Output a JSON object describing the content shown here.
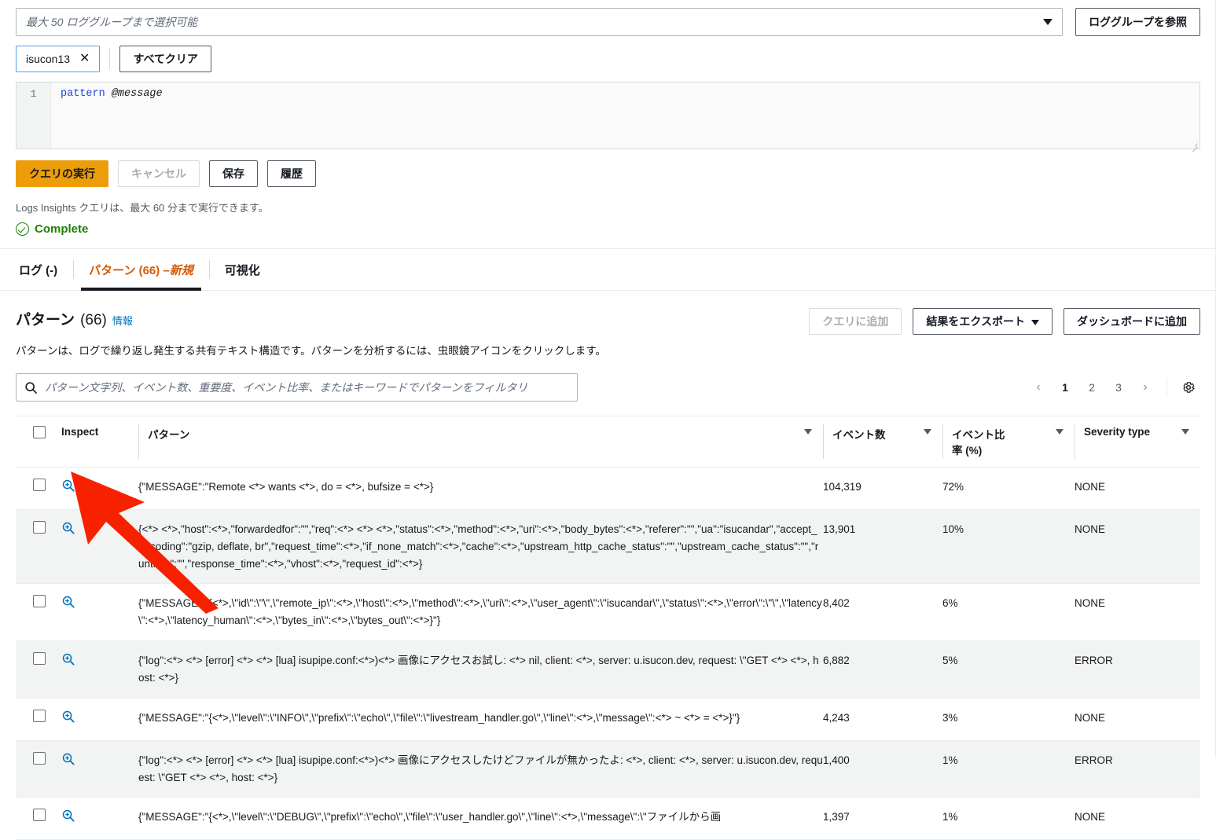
{
  "query_panel": {
    "log_group_placeholder": "最大 50 ロググループまで選択可能",
    "browse_button": "ロググループを参照",
    "selected_tokens": [
      {
        "label": "isucon13",
        "remove": "✕"
      }
    ],
    "clear_all_button": "すべてクリア",
    "editor": {
      "line_number": "1",
      "keyword": "pattern",
      "field": "@message"
    },
    "run_button": "クエリの実行",
    "cancel_button": "キャンセル",
    "save_button": "保存",
    "history_button": "履歴",
    "hint": "Logs Insights クエリは、最大 60 分まで実行できます。",
    "status": "Complete"
  },
  "tabs": [
    {
      "label": "ログ (-)",
      "active": false
    },
    {
      "label": "パターン (66) – ",
      "suffix": "新規",
      "active": true
    },
    {
      "label": "可視化",
      "active": false
    }
  ],
  "patterns_section": {
    "title": "パターン",
    "count": "(66)",
    "info_link": "情報",
    "description": "パターンは、ログで繰り返し発生する共有テキスト構造です。パターンを分析するには、虫眼鏡アイコンをクリックします。",
    "add_to_query_button": "クエリに追加",
    "export_results_button": "結果をエクスポート",
    "add_to_dashboard_button": "ダッシュボードに追加",
    "search_placeholder": "パターン文字列、イベント数、重要度、イベント比率、またはキーワードでパターンをフィルタリ",
    "pagination": {
      "prev": "‹",
      "pages": [
        "1",
        "2",
        "3"
      ],
      "current": "1",
      "next": "›",
      "settings_icon": "gear-icon"
    }
  },
  "table": {
    "columns": {
      "inspect": "Inspect",
      "pattern": "パターン",
      "event_count": "イベント数",
      "event_ratio": "イベント比率 (%)",
      "severity": "Severity type"
    },
    "rows": [
      {
        "pattern": "{\"MESSAGE\":\"Remote <*> wants <*>, do = <*>, bufsize = <*>}",
        "count": "104,319",
        "ratio": "72%",
        "severity": "NONE"
      },
      {
        "pattern": "{<*> <*>,\"host\":<*>,\"forwardedfor\":\"\",\"req\":<*> <*> <*>,\"status\":<*>,\"method\":<*>,\"uri\":<*>,\"body_bytes\":<*>,\"referer\":\"\",\"ua\":\"isucandar\",\"accept_encoding\":\"gzip, deflate, br\",\"request_time\":<*>,\"if_none_match\":<*>,\"cache\":<*>,\"upstream_http_cache_status\":\"\",\"upstream_cache_status\":\"\",\"runtime\":\"\",\"response_time\":<*>,\"vhost\":<*>,\"request_id\":<*>}",
        "count": "13,901",
        "ratio": "10%",
        "severity": "NONE"
      },
      {
        "pattern": "{\"MESSAGE\":\"{<*>,\\\"id\\\":\\\"\\\",\\\"remote_ip\\\":<*>,\\\"host\\\":<*>,\\\"method\\\":<*>,\\\"uri\\\":<*>,\\\"user_agent\\\":\\\"isucandar\\\",\\\"status\\\":<*>,\\\"error\\\":\\\"\\\",\\\"latency\\\":<*>,\\\"latency_human\\\":<*>,\\\"bytes_in\\\":<*>,\\\"bytes_out\\\":<*>}\"}",
        "count": "8,402",
        "ratio": "6%",
        "severity": "NONE"
      },
      {
        "pattern": "{\"log\":<*> <*> [error] <*> <*> [lua] isupipe.conf:<*>)<*> 画像にアクセスお試し: <*> nil, client: <*>, server: u.isucon.dev, request: \\\"GET <*> <*>, host: <*>}",
        "count": "6,882",
        "ratio": "5%",
        "severity": "ERROR"
      },
      {
        "pattern": "{\"MESSAGE\":\"{<*>,\\\"level\\\":\\\"INFO\\\",\\\"prefix\\\":\\\"echo\\\",\\\"file\\\":\\\"livestream_handler.go\\\",\\\"line\\\":<*>,\\\"message\\\":<*> ~ <*> = <*>}\"}",
        "count": "4,243",
        "ratio": "3%",
        "severity": "NONE"
      },
      {
        "pattern": "{\"log\":<*> <*> [error] <*> <*> [lua] isupipe.conf:<*>)<*> 画像にアクセスしたけどファイルが無かったよ: <*>, client: <*>, server: u.isucon.dev, request: \\\"GET <*> <*>, host: <*>}",
        "count": "1,400",
        "ratio": "1%",
        "severity": "ERROR"
      },
      {
        "pattern": "{\"MESSAGE\":\"{<*>,\\\"level\\\":\\\"DEBUG\\\",\\\"prefix\\\":\\\"echo\\\",\\\"file\\\":\\\"user_handler.go\\\",\\\"line\\\":<*>,\\\"message\\\":\\\"ファイルから画",
        "count": "1,397",
        "ratio": "1%",
        "severity": "NONE"
      }
    ]
  },
  "annotation": {
    "arrow_color": "#f72100"
  },
  "colors": {
    "accent_orange": "#ec9d0a",
    "tab_active": "#d45b07",
    "link_blue": "#0073bb",
    "success_green": "#1d8102",
    "token_border": "#539fe5"
  }
}
